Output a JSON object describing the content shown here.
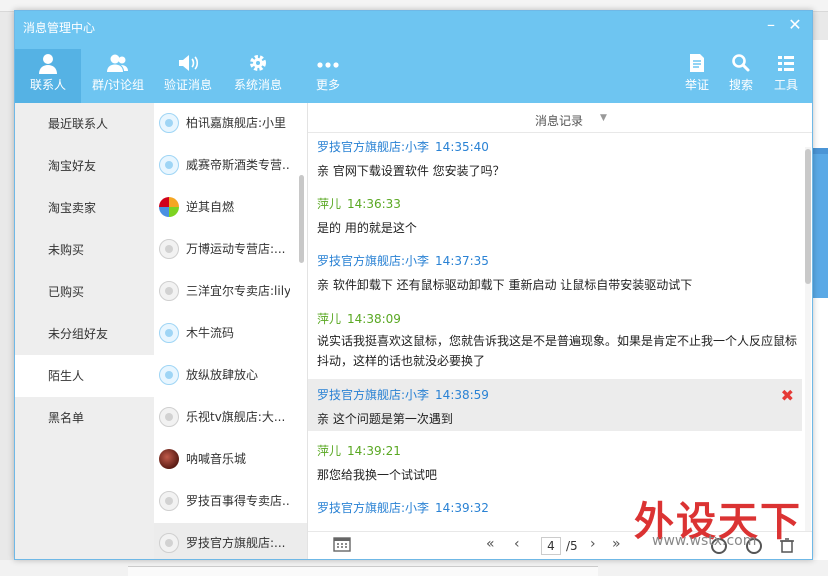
{
  "window": {
    "title": "消息管理中心",
    "minimize_label": "–",
    "close_label": "✕"
  },
  "nav": [
    {
      "label": "联系人",
      "icon": "person-icon",
      "active": true
    },
    {
      "label": "群/讨论组",
      "icon": "group-icon",
      "active": false
    },
    {
      "label": "验证消息",
      "icon": "speaker-icon",
      "active": false
    },
    {
      "label": "系统消息",
      "icon": "gear-icon",
      "active": false
    },
    {
      "label": "更多",
      "icon": "more-dots-icon",
      "active": false
    }
  ],
  "tools": [
    {
      "label": "举证",
      "icon": "document-icon"
    },
    {
      "label": "搜索",
      "icon": "search-icon"
    },
    {
      "label": "工具",
      "icon": "list-icon"
    }
  ],
  "categories": [
    {
      "label": "最近联系人",
      "active": false
    },
    {
      "label": "淘宝好友",
      "active": false
    },
    {
      "label": "淘宝卖家",
      "active": false
    },
    {
      "label": "未购买",
      "active": false
    },
    {
      "label": "已购买",
      "active": false
    },
    {
      "label": "未分组好友",
      "active": false
    },
    {
      "label": "陌生人",
      "active": true
    },
    {
      "label": "黑名单",
      "active": false
    }
  ],
  "contacts": [
    {
      "name": "柏讯嘉旗舰店:小里",
      "avatar": "blue"
    },
    {
      "name": "威赛帝斯酒类专营...",
      "avatar": "blue"
    },
    {
      "name": "逆其自燃",
      "avatar": "multi"
    },
    {
      "name": "万博运动专营店:...",
      "avatar": "gray"
    },
    {
      "name": "三洋宜尔专卖店:lily",
      "avatar": "gray"
    },
    {
      "name": "木牛流码",
      "avatar": "blue"
    },
    {
      "name": "放纵放肆放心",
      "avatar": "blue"
    },
    {
      "name": "乐视tv旗舰店:大...",
      "avatar": "gray"
    },
    {
      "name": "呐喊音乐城",
      "avatar": "photo"
    },
    {
      "name": "罗技百事得专卖店...",
      "avatar": "gray"
    },
    {
      "name": "罗技官方旗舰店:...",
      "avatar": "gray",
      "active": true
    }
  ],
  "chat": {
    "header_label": "消息记录",
    "messages": [
      {
        "sender": "罗技官方旗舰店:小李",
        "time": "14:35:40",
        "text": "亲 官网下载设置软件 您安装了吗？",
        "color": "blue"
      },
      {
        "sender": "萍儿",
        "time": "14:36:33",
        "text": "是的 用的就是这个",
        "color": "green"
      },
      {
        "sender": "罗技官方旗舰店:小李",
        "time": "14:37:35",
        "text": "亲 软件卸载下 还有鼠标驱动卸载下  重新启动 让鼠标自带安装驱动试下",
        "color": "blue"
      },
      {
        "sender": "萍儿",
        "time": "14:38:09",
        "text": "说实话我挺喜欢这鼠标，您就告诉我这是不是普遍现象。如果是肯定不止我一个人反应鼠标抖动，这样的话也就没必要换了",
        "color": "green"
      },
      {
        "sender": "罗技官方旗舰店:小李",
        "time": "14:38:59",
        "text": "亲  这个问题是第一次遇到",
        "color": "blue",
        "highlight": true
      },
      {
        "sender": "萍儿",
        "time": "14:39:21",
        "text": "那您给我换一个试试吧",
        "color": "green"
      },
      {
        "sender": "罗技官方旗舰店:小李",
        "time": "14:39:32",
        "text": "",
        "color": "blue"
      }
    ]
  },
  "pagination": {
    "current": "4",
    "total": "/5"
  },
  "watermark": {
    "text": "外设天下",
    "url": "www.wstx.com"
  },
  "colors": {
    "header": "#6ec5f1",
    "sender_blue": "#2a82d4",
    "sender_green": "#5aa823",
    "delete_red": "#e53935"
  }
}
